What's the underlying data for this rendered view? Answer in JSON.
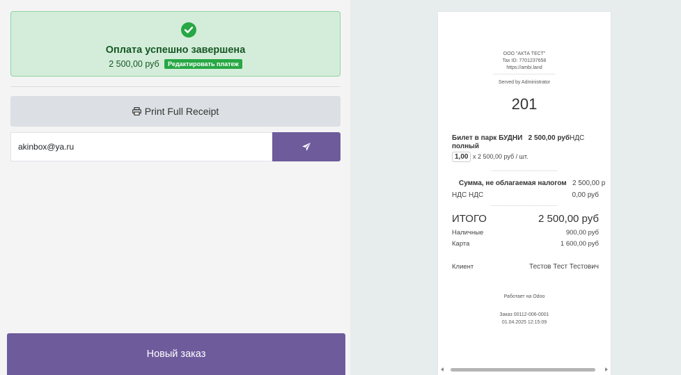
{
  "payment": {
    "status_title": "Оплата успешно завершена",
    "amount": "2 500,00 руб",
    "edit_label": "Редактировать платеж"
  },
  "actions": {
    "print_label": "Print Full Receipt",
    "email_value": "akinbox@ya.ru",
    "new_order_label": "Новый заказ"
  },
  "receipt": {
    "company": "ООО \"АКТА ТЕСТ\"",
    "tax_id": "Tax ID: 7701237658",
    "website": "https://ambi.land",
    "dashes_short": "------------------------------------",
    "served_by": "Served by Administrator",
    "order_number": "201",
    "item": {
      "name": "Билет в парк БУДНИ",
      "price": "2 500,00 руб",
      "tax_tag": "НДС",
      "name_cont": "полный",
      "qty": "1,00",
      "unit_price": "x 2 500,00 руб / шт."
    },
    "dashes": "--------------------------------------",
    "untaxed_label": "Сумма, не облагаемая налогом",
    "untaxed_value": "2 500,00 р",
    "tax_label": "НДС  НДС",
    "tax_value": "0,00 руб",
    "total_label": "ИТОГО",
    "total_value": "2 500,00 руб",
    "payments": [
      {
        "label": "Наличные",
        "value": "900,00 руб"
      },
      {
        "label": "Карта",
        "value": "1 600,00 руб"
      }
    ],
    "client_label": "Клиент",
    "client_value": "Тестов Тест Тестович",
    "powered_by": "Работает на Odoo",
    "order_ref": "Заказ 00112-006-0001",
    "datetime": "01.04.2025 12:15:09"
  },
  "colors": {
    "success_bg": "#d4edda",
    "success_text": "#155724",
    "primary": "#6e5b9c"
  }
}
